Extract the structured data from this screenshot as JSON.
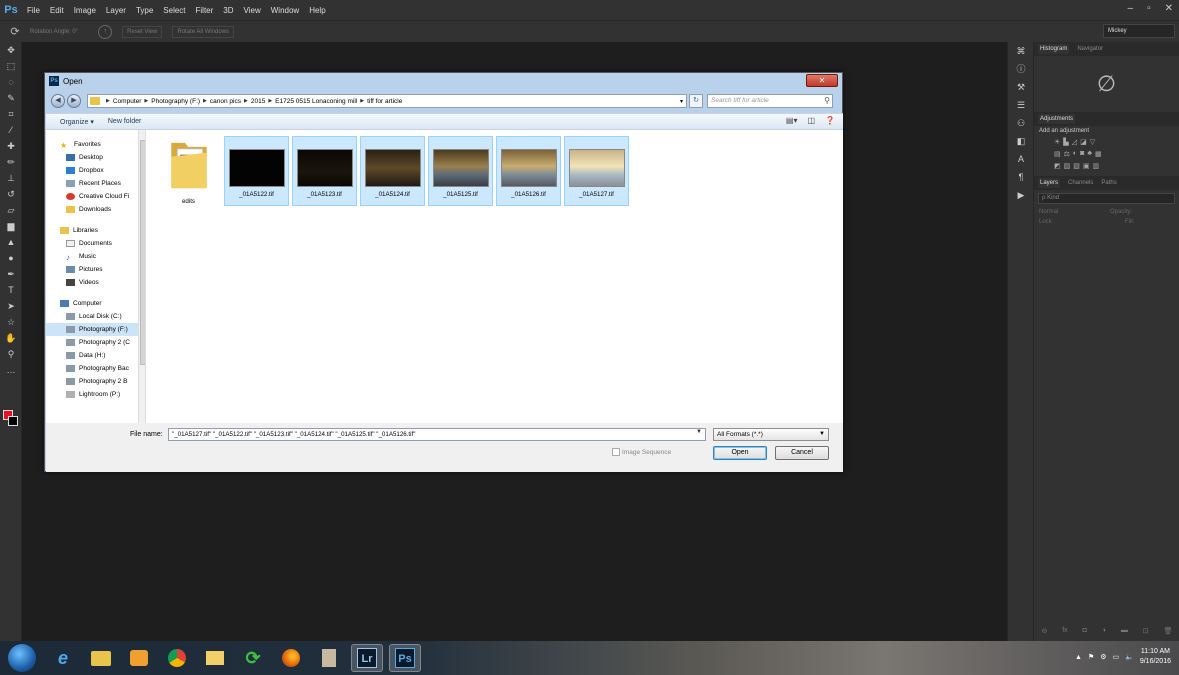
{
  "app": {
    "logo": "Ps",
    "menus": [
      "File",
      "Edit",
      "Image",
      "Layer",
      "Type",
      "Select",
      "Filter",
      "3D",
      "View",
      "Window",
      "Help"
    ],
    "window_controls": [
      "–",
      "▫",
      "✕"
    ]
  },
  "options_bar": {
    "rotation_label": "Rotation Angle:  0°",
    "reset_view": "Reset View",
    "rotate_all": "Rotate All Windows",
    "workspace": "Mickey"
  },
  "panels": {
    "tabs_top": [
      "Histogram",
      "Navigator"
    ],
    "adjustments_title": "Adjustments",
    "add_adjustment": "Add an adjustment",
    "tabs_layers": [
      "Layers",
      "Channels",
      "Paths"
    ],
    "kind_placeholder": "ρ Kind",
    "blend_mode": "Normal",
    "opacity_label": "Opacity:",
    "lock_label": "Lock:",
    "fill_label": "Fill:"
  },
  "dialog": {
    "title": "Open",
    "breadcrumb": [
      "Computer",
      "Photography (F:)",
      "canon pics",
      "2015",
      "E1725 0515 Lonaconing mill",
      "tiff for article"
    ],
    "search_placeholder": "Search tiff for article",
    "organize_label": "Organize ▾",
    "new_folder_label": "New folder",
    "nav": {
      "favorites_head": "Favorites",
      "favorites": [
        "Desktop",
        "Dropbox",
        "Recent Places",
        "Creative Cloud Fi",
        "Downloads"
      ],
      "libraries_head": "Libraries",
      "libraries": [
        "Documents",
        "Music",
        "Pictures",
        "Videos"
      ],
      "computer_head": "Computer",
      "computer": [
        "Local Disk (C:)",
        "Photography (F:)",
        "Photography 2 (C",
        "Data (H:)",
        "Photography Bac",
        "Photography 2 B",
        "Lightroom (P:)"
      ]
    },
    "files": [
      {
        "name": "edits",
        "kind": "folder"
      },
      {
        "name": "_01A5122.tif",
        "kind": "image"
      },
      {
        "name": "_01A5123.tif",
        "kind": "image"
      },
      {
        "name": "_01A5124.tif",
        "kind": "image"
      },
      {
        "name": "_01A5125.tif",
        "kind": "image"
      },
      {
        "name": "_01A5126.tif",
        "kind": "image"
      },
      {
        "name": "_01A5127.tif",
        "kind": "image"
      }
    ],
    "file_name_label": "File name:",
    "file_name_value": "\"_01A5127.tif\" \"_01A5122.tif\" \"_01A5123.tif\" \"_01A5124.tif\" \"_01A5125.tif\" \"_01A5126.tif\"",
    "format_value": "All Formats (*.*)",
    "image_sequence_label": "Image Sequence",
    "open_label": "Open",
    "cancel_label": "Cancel"
  },
  "taskbar": {
    "time": "11:10 AM",
    "date": "9/16/2016",
    "lr_label": "Lr",
    "ps_label": "Ps"
  }
}
